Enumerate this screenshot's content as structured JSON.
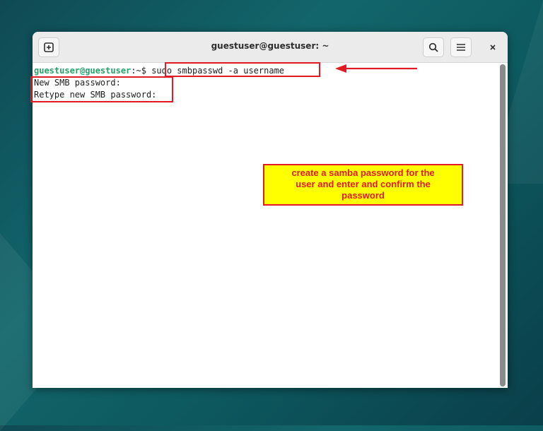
{
  "window": {
    "title": "guestuser@guestuser: ~"
  },
  "terminal": {
    "prompt_user": "guestuser@guestuser",
    "prompt_path": ":~$ ",
    "command": "sudo smbpasswd -a username",
    "output": [
      "New SMB password:",
      "Retype new SMB password:"
    ]
  },
  "annotation": {
    "lines": [
      "create a samba password for the",
      "user and enter and confirm the",
      "password"
    ]
  },
  "icons": {
    "new_tab": "new-tab-icon",
    "search": "search-icon",
    "menu": "hamburger-menu-icon",
    "close": "close-icon"
  },
  "colors": {
    "accent_red": "#e01b24",
    "callout_bg": "#ffff00",
    "prompt_green": "#26a269"
  }
}
